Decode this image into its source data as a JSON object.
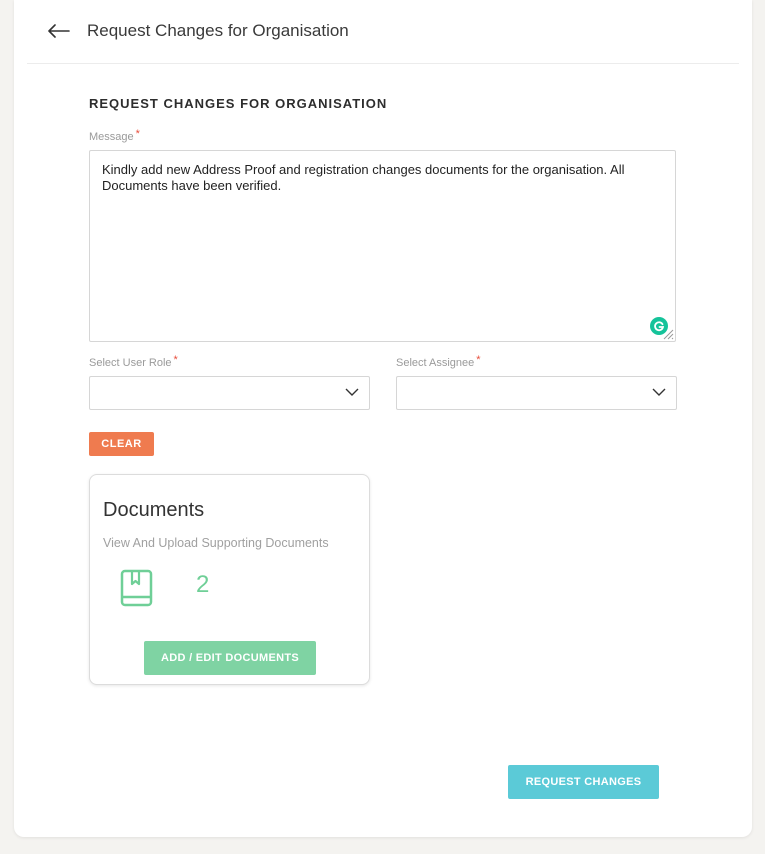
{
  "header": {
    "back_icon": "arrow-left-icon",
    "title": "Request Changes for Organisation"
  },
  "form": {
    "heading": "REQUEST CHANGES FOR ORGANISATION",
    "message_label": "Message",
    "required_mark": "*",
    "message_value": "Kindly add new Address Proof and registration changes documents for the organisation. All Documents have been verified.",
    "user_role_label": "Select User Role",
    "user_role_value": "",
    "assignee_label": "Select Assignee",
    "assignee_value": "",
    "clear_label": "CLEAR"
  },
  "documents": {
    "title": "Documents",
    "subtitle": "View And Upload Supporting Documents",
    "icon": "book-icon",
    "count": "2",
    "button_label": "ADD / EDIT DOCUMENTS"
  },
  "footer": {
    "request_label": "REQUEST CHANGES"
  },
  "colors": {
    "accent_orange": "#ef7b4f",
    "accent_green": "#7fd3a3",
    "accent_teal": "#5bcad7",
    "required_red": "#e84e3c",
    "grammarly_green": "#15c39a"
  }
}
